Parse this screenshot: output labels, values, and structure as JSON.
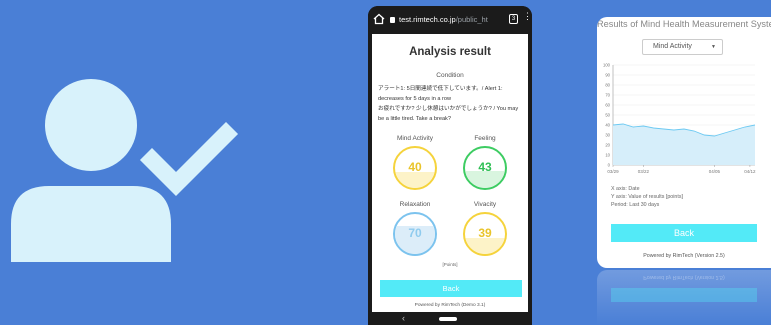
{
  "browser": {
    "url_host": "test.rimtech.co.jp",
    "url_path": "/public_ht",
    "tab_count": "3",
    "menu": "⋮",
    "nav_back": "‹"
  },
  "analysis": {
    "title": "Analysis result",
    "condition_label": "Condition",
    "alert_line1": "アラート1: 5日間連続で低下しています。/ Alert 1: decreases for 5 days in a row",
    "alert_line2": "お疲れですか? 少し休憩はいかがでしょうか? / You may be a little tired. Take a break?",
    "gauges": [
      {
        "label": "Mind Activity",
        "value": "40",
        "level": 0.4,
        "color": "#f5d33c",
        "fill": "#fdf3c8",
        "text": "#e9c42a"
      },
      {
        "label": "Feeling",
        "value": "43",
        "level": 0.43,
        "color": "#3dcc62",
        "fill": "#d9f5df",
        "text": "#2fbf55"
      },
      {
        "label": "Relaxation",
        "value": "70",
        "level": 0.7,
        "color": "#7cc3ee",
        "fill": "#dcedf9",
        "text": "#8fcbee"
      },
      {
        "label": "Vivacity",
        "value": "39",
        "level": 0.39,
        "color": "#f5d33c",
        "fill": "#fdf3c8",
        "text": "#e9c42a"
      }
    ],
    "points_label": "[Points]",
    "back_button": "Back",
    "powered": "Powered by RimTech (Demo 3.1)"
  },
  "results": {
    "title": "Results of Mind Health Measurement System",
    "select_value": "Mind Activity",
    "info_lines": [
      "X axis: Date",
      "Y axis: Value of results [points]",
      "Period: Last 30 days"
    ],
    "back_button": "Back",
    "powered": "Powered by RimTech (Version 2.5)"
  },
  "chart_data": {
    "type": "area",
    "x": [
      "03/16",
      "03/18",
      "03/20",
      "03/22",
      "03/24",
      "03/26",
      "03/28",
      "03/30",
      "04/01",
      "04/03",
      "04/05",
      "04/07",
      "04/09",
      "04/11",
      "04/13"
    ],
    "tick_labels": [
      "03/22",
      "03/29",
      "04/05",
      "04/12"
    ],
    "series": [
      {
        "values": [
          40,
          41,
          38,
          39,
          37,
          36,
          35,
          36,
          34,
          30,
          29,
          32,
          35,
          38,
          40
        ]
      }
    ],
    "ylim": [
      0,
      100
    ],
    "y_ticks": [
      0,
      10,
      20,
      30,
      40,
      50,
      60,
      70,
      80,
      90,
      100
    ],
    "grid": true,
    "line_color": "#6cc9f2",
    "fill_color": "#d6eefa"
  },
  "colors": {
    "background": "#4a7fd6",
    "user_icon": "#d8f2fb",
    "check": "#d8f2fb",
    "accent": "#53eaf7"
  }
}
